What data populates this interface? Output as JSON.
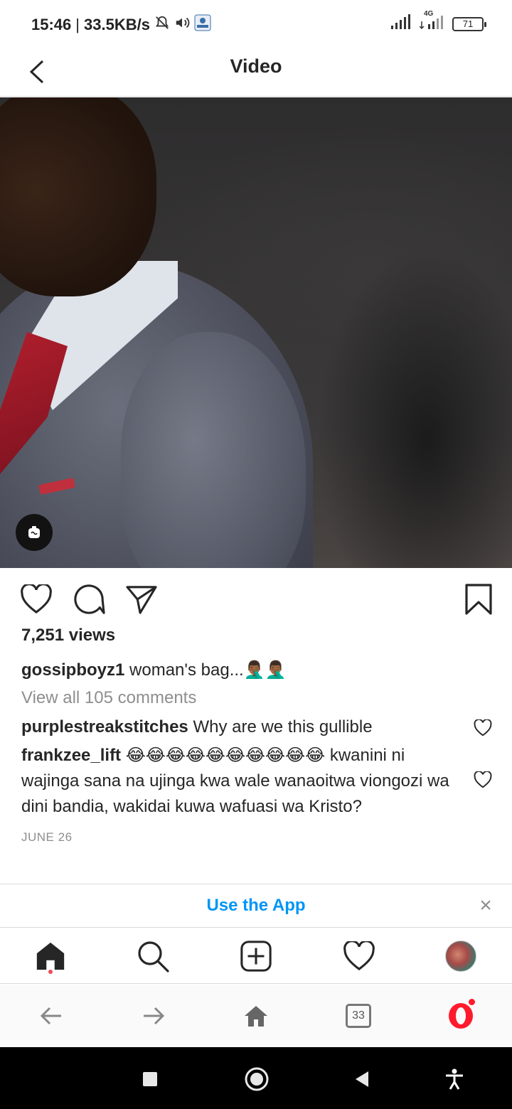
{
  "status_bar": {
    "time": "15:46",
    "separator": "|",
    "speed": "33.5KB/s",
    "network_label": "4G",
    "battery": "71",
    "icons": [
      "alarm-off-icon",
      "volume-icon",
      "app-notification-icon",
      "signal-icon",
      "signal-4g-icon",
      "battery-icon"
    ]
  },
  "header": {
    "title": "Video",
    "back_icon": "chevron-left-icon"
  },
  "video": {
    "overlay_icon": "video-sound-icon"
  },
  "actions": {
    "icons": [
      "heart-icon",
      "comment-icon",
      "share-icon",
      "bookmark-icon"
    ]
  },
  "post": {
    "views": "7,251 views",
    "caption_user": "gossipboyz1",
    "caption_text": "woman's bag...🤦🏾‍♂️🤦🏾‍♂️",
    "view_all_comments": "View all 105 comments",
    "comments": [
      {
        "user": "purplestreakstitches",
        "text": "Why are we this gullible"
      },
      {
        "user": "frankzee_lift",
        "text": "😂😂😂😂😂😂😂😂😂😂 kwanini ni wajinga sana na ujinga kwa wale wanaoitwa viongozi wa dini bandia, wakidai kuwa wafuasi wa Kristo?"
      }
    ],
    "date": "JUNE 26"
  },
  "app_banner": {
    "label": "Use the App",
    "close": "×"
  },
  "ig_nav": {
    "items": [
      "home-icon",
      "search-icon",
      "new-post-icon",
      "activity-heart-icon",
      "profile-avatar"
    ]
  },
  "browser_bar": {
    "tabs_count": "33",
    "items": [
      "back-arrow-icon",
      "forward-arrow-icon",
      "browser-home-icon",
      "tabs-icon",
      "opera-menu-icon"
    ]
  },
  "colors": {
    "link_blue": "#0095f6",
    "text_dark": "#262626",
    "text_muted": "#8e8e8e",
    "notification_red": "#ed4956",
    "opera_red": "#ff1b2d"
  }
}
